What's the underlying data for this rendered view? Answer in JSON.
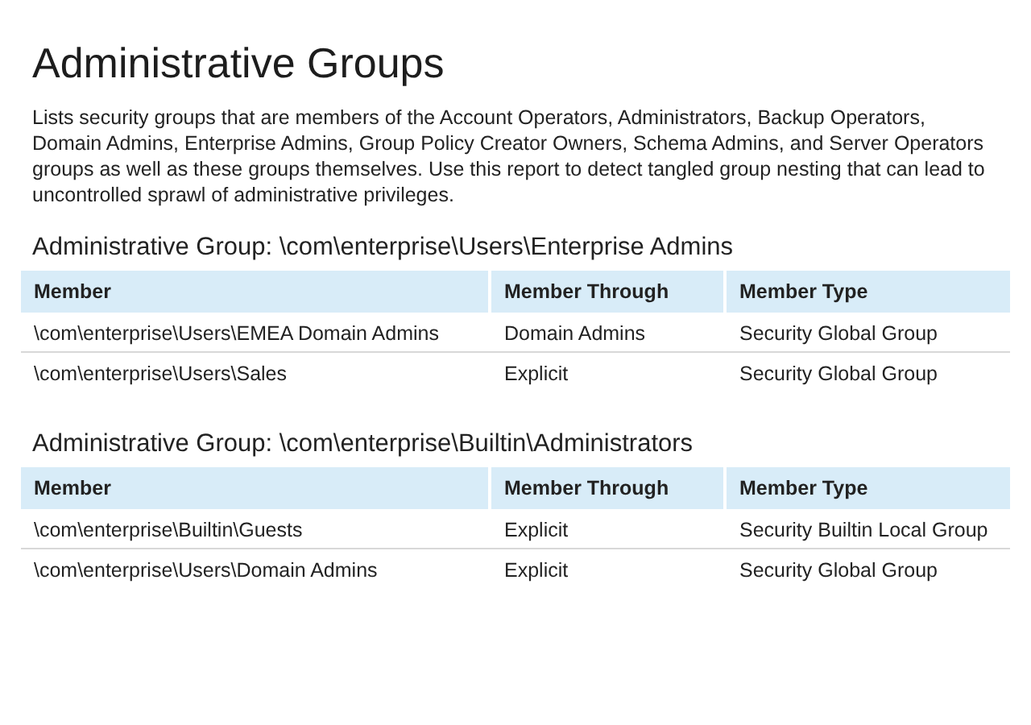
{
  "title": "Administrative Groups",
  "description": "Lists security groups that are members of the Account Operators, Administrators, Backup Operators, Domain Admins, Enterprise Admins, Group Policy Creator Owners, Schema Admins, and Server Operators groups as well as these groups themselves. Use this report to detect tangled group nesting that can lead to uncontrolled sprawl of administrative privileges.",
  "sections": [
    {
      "heading": "Administrative Group: \\com\\enterprise\\Users\\Enterprise Admins",
      "columns": [
        "Member",
        "Member Through",
        "Member Type"
      ],
      "rows": [
        [
          "\\com\\enterprise\\Users\\EMEA Domain Admins",
          "Domain Admins",
          "Security Global Group"
        ],
        [
          "\\com\\enterprise\\Users\\Sales",
          "Explicit",
          "Security Global Group"
        ]
      ]
    },
    {
      "heading": "Administrative Group: \\com\\enterprise\\Builtin\\Administrators",
      "columns": [
        "Member",
        "Member Through",
        "Member Type"
      ],
      "rows": [
        [
          "\\com\\enterprise\\Builtin\\Guests",
          "Explicit",
          "Security Builtin Local Group"
        ],
        [
          "\\com\\enterprise\\Users\\Domain Admins",
          "Explicit",
          "Security Global Group"
        ]
      ]
    }
  ]
}
